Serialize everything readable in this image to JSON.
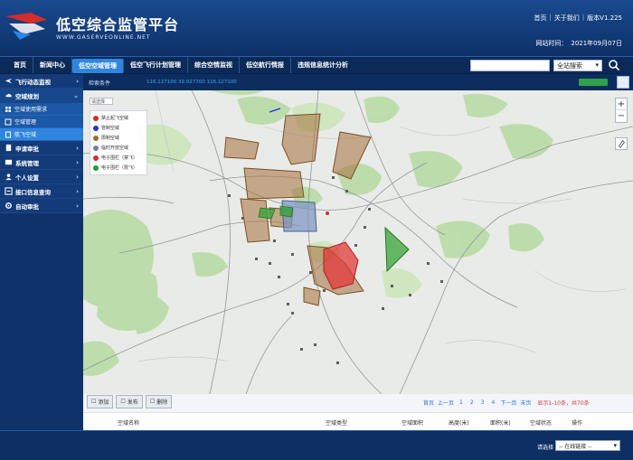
{
  "header": {
    "title": "低空综合监管平台",
    "subtitle": "WWW.GASERVEONLINE.NET",
    "links": [
      "首页",
      "关于我们",
      "版本V1.225"
    ],
    "time_label": "网站时间：",
    "time_value": "2021年09月07日"
  },
  "nav": {
    "items": [
      "首页",
      "新闻中心",
      "低空空域管理",
      "低空飞行计划管理",
      "综合空情监视",
      "低空航行情报",
      "违规信息统计分析"
    ],
    "active_index": 2,
    "search_placeholder": "",
    "search_scope": "全站搜索"
  },
  "sidebar": {
    "sections": [
      {
        "label": "飞行动态监视",
        "icon": "plane-icon",
        "open": false
      },
      {
        "label": "空域规划",
        "icon": "cloud-icon",
        "open": true,
        "children": [
          {
            "label": "空域使用需求",
            "active": false
          },
          {
            "label": "空域管理",
            "active": false
          },
          {
            "label": "航飞空域",
            "active": true
          }
        ]
      },
      {
        "label": "申请审批",
        "icon": "document-icon",
        "open": false
      },
      {
        "label": "系统管理",
        "icon": "settings-icon",
        "open": false
      },
      {
        "label": "个人设置",
        "icon": "user-icon",
        "open": false
      },
      {
        "label": "接口信息查询",
        "icon": "link-icon",
        "open": false
      },
      {
        "label": "自动审批",
        "icon": "gear-icon",
        "open": false
      }
    ]
  },
  "map": {
    "header_label": "检索条件",
    "header_coords": "116.127100   39.927700   116.127100",
    "filter_label": "请选择",
    "legend": [
      {
        "label": "禁止起飞空域",
        "color": "#d62b2b"
      },
      {
        "label": "管制空域",
        "color": "#1f2fd6"
      },
      {
        "label": "限制空域",
        "color": "#a16a2f"
      },
      {
        "label": "临时开放空域",
        "color": "#6e7fa8"
      },
      {
        "label": "电子围栏（禁飞）",
        "color": "#d62b2b"
      },
      {
        "label": "电子围栏（限飞）",
        "color": "#1b9e2c"
      }
    ],
    "zoom_in": "+",
    "zoom_out": "−",
    "actions": [
      "添加",
      "发布",
      "删除"
    ]
  },
  "pager": {
    "first": "首页",
    "prev": "上一页",
    "pages": [
      "1",
      "2",
      "3",
      "4"
    ],
    "next": "下一页",
    "last": "末页",
    "info": "显示1-10条，共70条"
  },
  "table": {
    "columns": [
      "空域名称",
      "空域类型",
      "空域面积",
      "高度(米)",
      "面积(米)",
      "空域状态",
      "操作"
    ]
  },
  "footer": {
    "label": "请选择",
    "select_value": "-- 在线链接 --"
  }
}
